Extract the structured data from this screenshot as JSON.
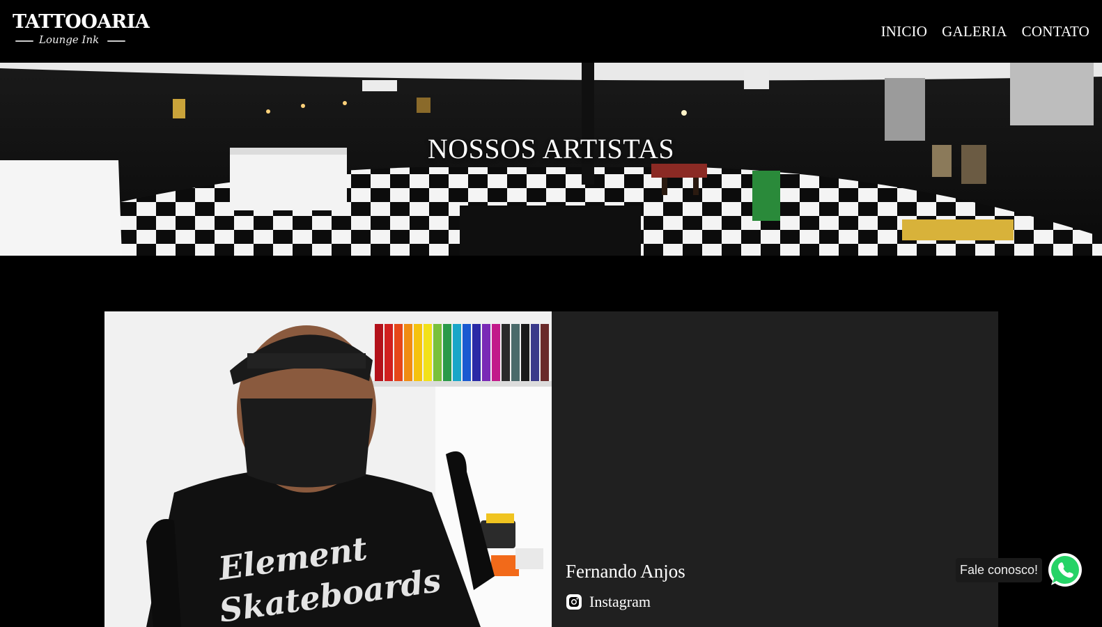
{
  "header": {
    "logo_main": "TATTOOARIA",
    "logo_sub": "Lounge Ink",
    "nav": [
      "INICIO",
      "GALERIA",
      "CONTATO"
    ]
  },
  "hero": {
    "title": "NOSSOS ARTISTAS"
  },
  "artist": {
    "name": "Fernando Anjos",
    "instagram_label": "Instagram",
    "shirt_text_1": "Element",
    "shirt_text_2": "Skateboards"
  },
  "whatsapp": {
    "label": "Fale conosco!"
  },
  "colors": {
    "background": "#000000",
    "card": "#202020",
    "whatsapp_green": "#25D366"
  },
  "icons": {
    "instagram": "instagram-icon",
    "whatsapp": "whatsapp-icon"
  }
}
